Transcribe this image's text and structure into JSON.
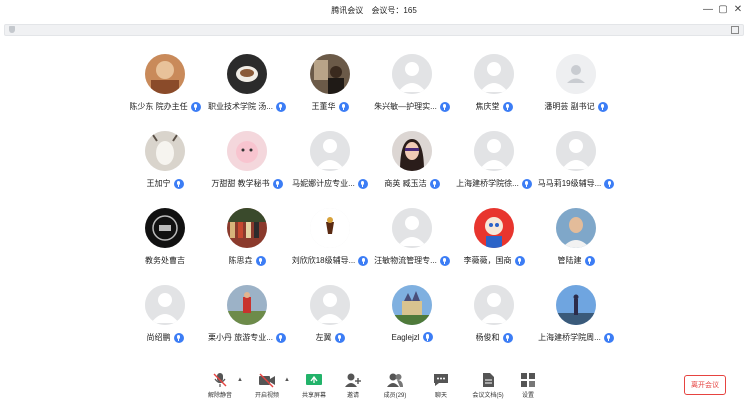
{
  "window": {
    "title": "腾讯会议",
    "meeting_id_label": "会议号：165",
    "controls": [
      "—",
      "▢",
      "✕"
    ]
  },
  "participants": [
    {
      "name": "陈少东 院办主任",
      "avatar": "photo-warm",
      "mic": true
    },
    {
      "name": "职业技术学院 汤...",
      "avatar": "photo-dark-cup",
      "mic": true
    },
    {
      "name": "王董华",
      "avatar": "photo-room",
      "mic": true
    },
    {
      "name": "朱兴敏—护理实...",
      "avatar": "default-gray",
      "mic": true
    },
    {
      "name": "焦庆堂",
      "avatar": "default-gray",
      "mic": true
    },
    {
      "name": "潘明芸 副书记",
      "avatar": "default-light",
      "mic": true
    },
    {
      "name": "王加宁",
      "avatar": "photo-goat",
      "mic": true
    },
    {
      "name": "万甜甜 教学秘书",
      "avatar": "photo-pink",
      "mic": true
    },
    {
      "name": "马妮娜计应专业...",
      "avatar": "default-gray",
      "mic": true
    },
    {
      "name": "商英 臧玉洁",
      "avatar": "photo-girl",
      "mic": true
    },
    {
      "name": "上海建桥学院徐...",
      "avatar": "default-gray",
      "mic": true
    },
    {
      "name": "马马莉19级辅导...",
      "avatar": "default-gray",
      "mic": true
    },
    {
      "name": "教务处曹吉",
      "avatar": "photo-black-logo",
      "mic": false
    },
    {
      "name": "陈思垚",
      "avatar": "photo-crowd",
      "mic": true
    },
    {
      "name": "刘欣欣18级辅导...",
      "avatar": "photo-small-logo",
      "mic": true
    },
    {
      "name": "汪敏物流管理专...",
      "avatar": "default-gray",
      "mic": true
    },
    {
      "name": "李薇薇，国商",
      "avatar": "photo-cartoon",
      "mic": true
    },
    {
      "name": "管陆建",
      "avatar": "photo-man",
      "mic": true
    },
    {
      "name": "尚绍鹏",
      "avatar": "default-gray",
      "mic": true
    },
    {
      "name": "栗小丹 旅游专业...",
      "avatar": "photo-outdoor",
      "mic": true
    },
    {
      "name": "左翼",
      "avatar": "default-gray",
      "mic": true
    },
    {
      "name": "Eaglejzl",
      "avatar": "photo-castle",
      "mic": true
    },
    {
      "name": "杨俊和",
      "avatar": "default-gray",
      "mic": true
    },
    {
      "name": "上海建桥学院周...",
      "avatar": "photo-sky",
      "mic": true
    }
  ],
  "toolbar": {
    "unmute": "解除静音",
    "video": "开启视频",
    "share": "共享屏幕",
    "invite": "邀请",
    "members": "成员(29)",
    "chat": "聊天",
    "docs": "会议文档(5)",
    "settings": "设置",
    "leave": "离开会议"
  },
  "colors": {
    "accent": "#3c7df5",
    "leave": "#e64340",
    "share_green": "#22b36a"
  }
}
